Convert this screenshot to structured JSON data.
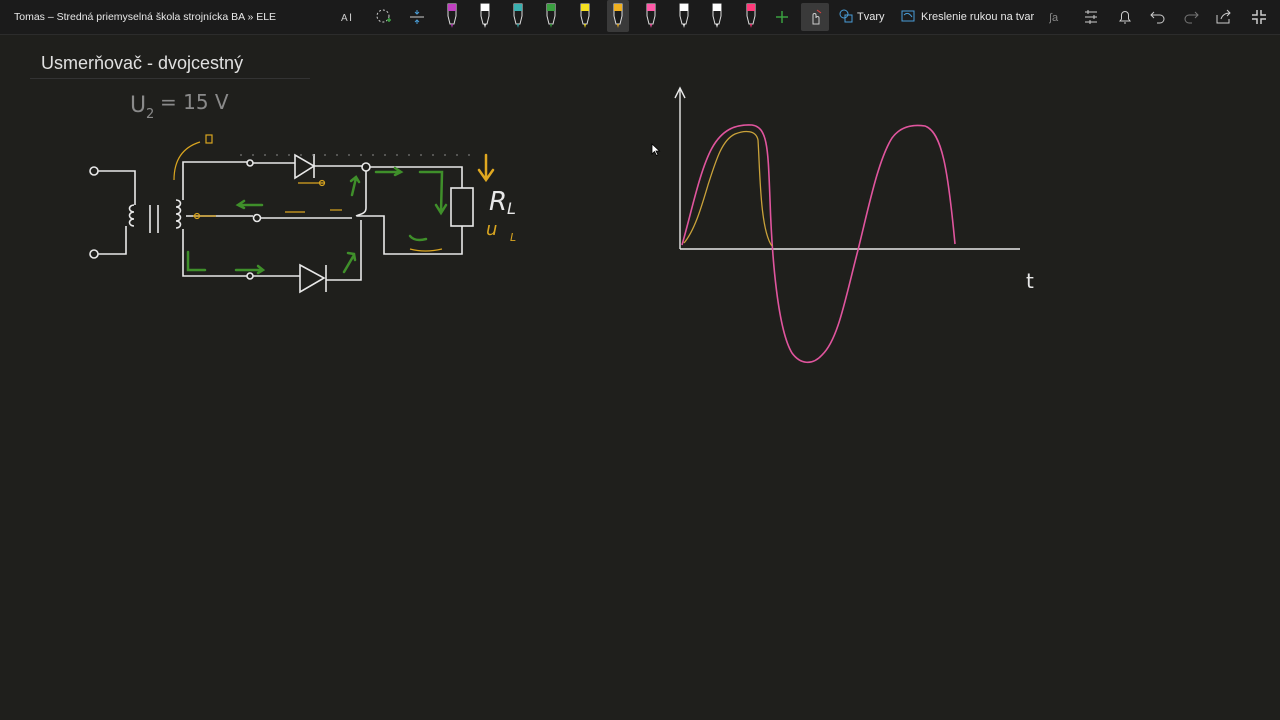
{
  "window": {
    "title": "Tomas – Stredná priemyselná škola strojnícka BA » ELE"
  },
  "toolbar": {
    "shapes_label": "Tvary",
    "ink_to_shape_label": "Kreslenie rukou na tvar",
    "pens": [
      {
        "color": "#c040c0"
      },
      {
        "color": "#ffffff"
      },
      {
        "color": "#3ab0b0"
      },
      {
        "color": "#3aa040"
      },
      {
        "color": "#f5e020"
      },
      {
        "color": "#f0b020"
      },
      {
        "color": "#ff5aa8"
      },
      {
        "color": "#ffffff"
      },
      {
        "color": "#ffffff"
      },
      {
        "color": "#ff3a7a"
      }
    ]
  },
  "page": {
    "title": "Usmerňovač - dvojcestný",
    "voltage_label": "U",
    "voltage_sub": "2",
    "voltage_value": "= 15 V",
    "resistor_label": "R",
    "resistor_sub": "L",
    "load_voltage_label": "u",
    "load_voltage_sub": "L",
    "time_axis_label": "t"
  },
  "colors": {
    "background": "#1f1f1c",
    "wire": "#e8e8e8",
    "current_arrow": "#3f8f2a",
    "annotation": "#d9a520",
    "sine": "#e0559e",
    "rectified": "#c9a23a"
  }
}
